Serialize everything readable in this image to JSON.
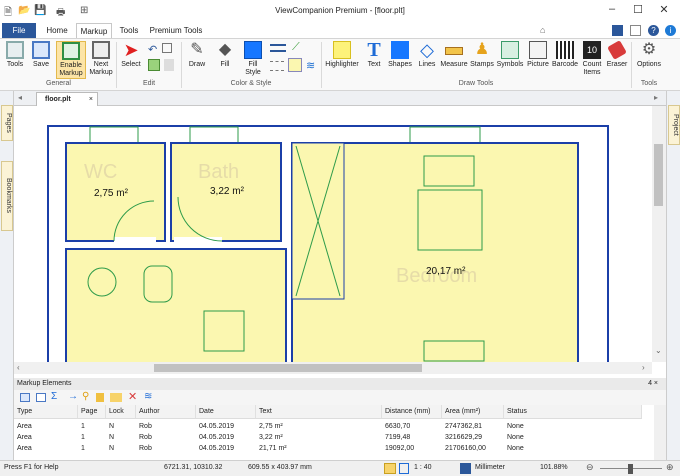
{
  "window": {
    "title": "ViewCompanion Premium - [floor.plt]"
  },
  "tabs": {
    "file": "File",
    "home": "Home",
    "markup": "Markup",
    "tools": "Tools",
    "premium": "Premium Tools"
  },
  "ribbon": {
    "tools": "Tools",
    "save": "Save",
    "enable_markup": "Enable Markup",
    "next_markup": "Next Markup",
    "select": "Select",
    "draw": "Draw",
    "fill": "Fill",
    "fill_style": "Fill Style",
    "highlighter": "Highlighter",
    "text": "Text",
    "shapes": "Shapes",
    "lines": "Lines",
    "measure": "Measure",
    "stamps": "Stamps",
    "symbols": "Symbols",
    "picture": "Picture",
    "barcode": "Barcode",
    "count_items": "Count Items",
    "eraser": "Eraser",
    "options": "Options",
    "groups": {
      "general": "General",
      "edit": "Edit",
      "color_style": "Color & Style",
      "draw_tools": "Draw Tools",
      "tools": "Tools"
    }
  },
  "side": {
    "pages": "Pages",
    "bookmarks": "Bookmarks",
    "project": "Project"
  },
  "document": {
    "tab": "floor.plt",
    "close": "×"
  },
  "plan": {
    "rooms": [
      {
        "name": "WC",
        "area": "2,75 m²"
      },
      {
        "name": "Bath",
        "area": "3,22 m²"
      },
      {
        "name": "Bedroom",
        "area": "20,17 m²"
      }
    ]
  },
  "panel": {
    "title": "Markup Elements",
    "pin": "4 ×",
    "columns": [
      "Type",
      "Page",
      "Lock",
      "Author",
      "Date",
      "Text",
      "Distance (mm)",
      "Area (mm²)",
      "Status"
    ],
    "rows": [
      [
        "Area",
        "1",
        "N",
        "Rob",
        "04.05.2019",
        "2,75 m²",
        "6630,70",
        "2747362,81",
        "None"
      ],
      [
        "Area",
        "1",
        "N",
        "Rob",
        "04.05.2019",
        "3,22 m²",
        "7199,48",
        "3216629,29",
        "None"
      ],
      [
        "Area",
        "1",
        "N",
        "Rob",
        "04.05.2019",
        "21,71 m²",
        "19092,00",
        "21706160,00",
        "None"
      ]
    ]
  },
  "status": {
    "help": "Press F1 for Help",
    "coords": "6721.31, 10310.32",
    "size": "609.55 x 403.97 mm",
    "scale": "1 : 40",
    "units": "Millimeter",
    "zoom": "101.88%"
  },
  "colors": {
    "file_tab": "#2b579a",
    "room_fill": "#fbf7b0",
    "wall": "#1b3fa8"
  }
}
